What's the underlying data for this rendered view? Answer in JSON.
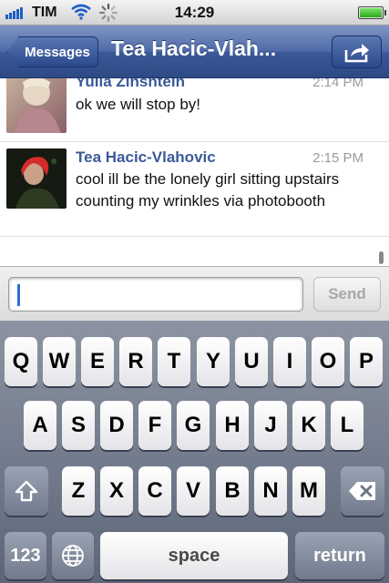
{
  "status_bar": {
    "carrier": "TIM",
    "time": "14:29",
    "battery_level": 1.0,
    "signal_bars": 5,
    "icons": [
      "signal-icon",
      "wifi-icon",
      "activity-spinner-icon",
      "battery-icon"
    ]
  },
  "nav": {
    "back_label": "Messages",
    "title": "Tea Hacic-Vlah...",
    "share_icon": "share-icon",
    "color": "#3b5998"
  },
  "messages": [
    {
      "sender": "Yulia Zinshtein",
      "time": "2:14 PM",
      "text": "ok we will stop by!"
    },
    {
      "sender": "Tea Hacic-Vlahovic",
      "time": "2:15 PM",
      "text": "cool ill be the lonely girl sitting upstairs counting my wrinkles via photobooth"
    }
  ],
  "compose": {
    "value": "",
    "send_label": "Send"
  },
  "keyboard": {
    "row1": [
      "Q",
      "W",
      "E",
      "R",
      "T",
      "Y",
      "U",
      "I",
      "O",
      "P"
    ],
    "row2": [
      "A",
      "S",
      "D",
      "F",
      "G",
      "H",
      "J",
      "K",
      "L"
    ],
    "row3": [
      "Z",
      "X",
      "C",
      "V",
      "B",
      "N",
      "M"
    ],
    "shift_icon": "shift-arrow-icon",
    "backspace_icon": "backspace-icon",
    "numbers_label": "123",
    "globe_icon": "globe-icon",
    "space_label": "space",
    "return_label": "return"
  }
}
